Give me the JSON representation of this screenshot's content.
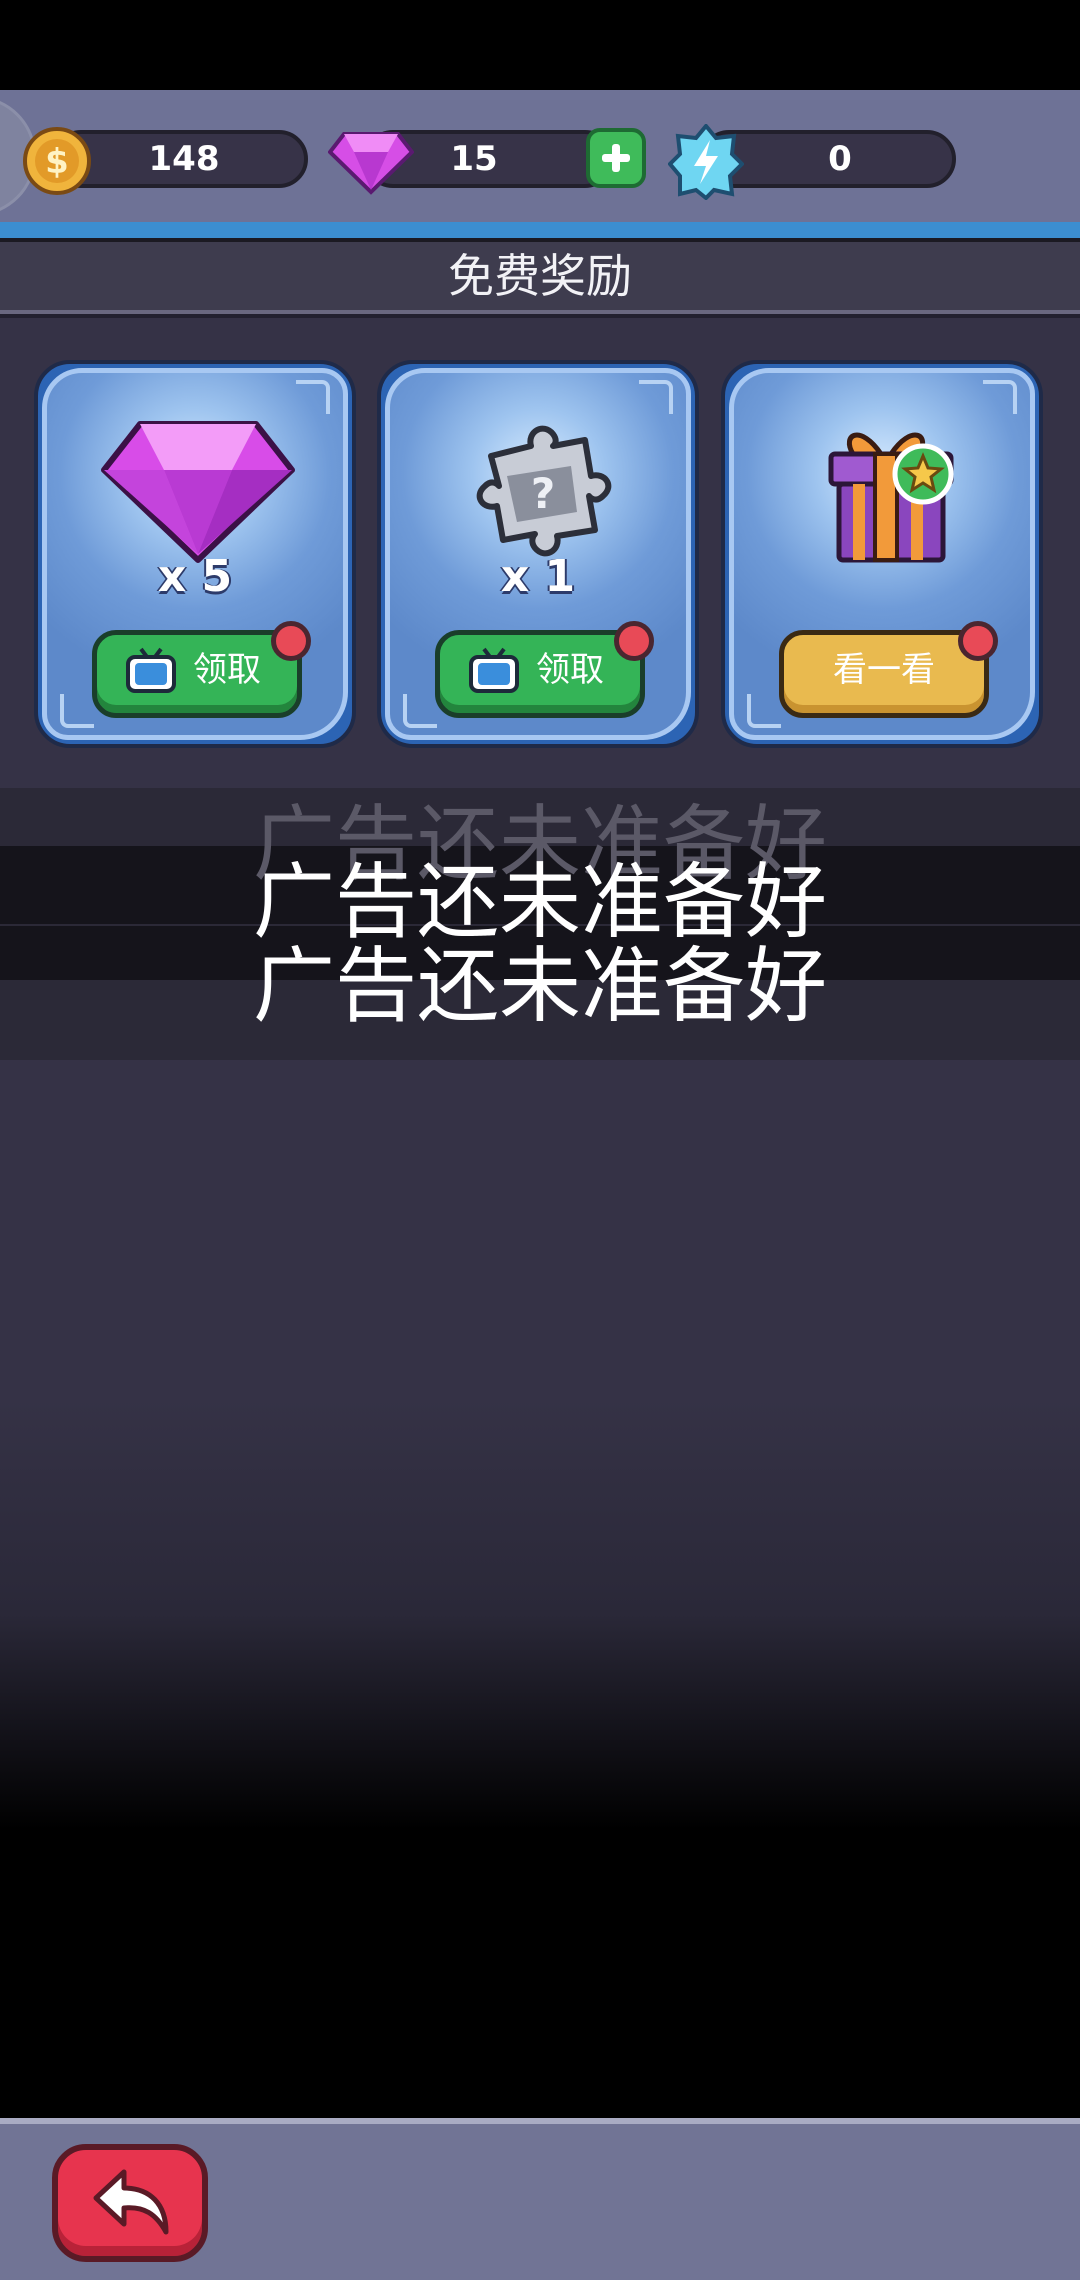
{
  "currency": {
    "coins": "148",
    "gems": "15",
    "energy": "0"
  },
  "title": "免费奖励",
  "cards": [
    {
      "quantity": "x 5",
      "button_label": "领取",
      "reward_icon": "diamond-icon"
    },
    {
      "quantity": "x 1",
      "button_label": "领取",
      "reward_icon": "mystery-puzzle-icon"
    },
    {
      "quantity": "",
      "button_label": "看一看",
      "reward_icon": "gift-box-icon"
    }
  ],
  "toasts": [
    "广告还未准备好",
    "广告还未准备好",
    "广告还未准备好"
  ],
  "colors": {
    "green_button": "#34b457",
    "yellow_button": "#e9ba4f",
    "back_button": "#e7344e",
    "card_blue": "#6f9bd8"
  }
}
